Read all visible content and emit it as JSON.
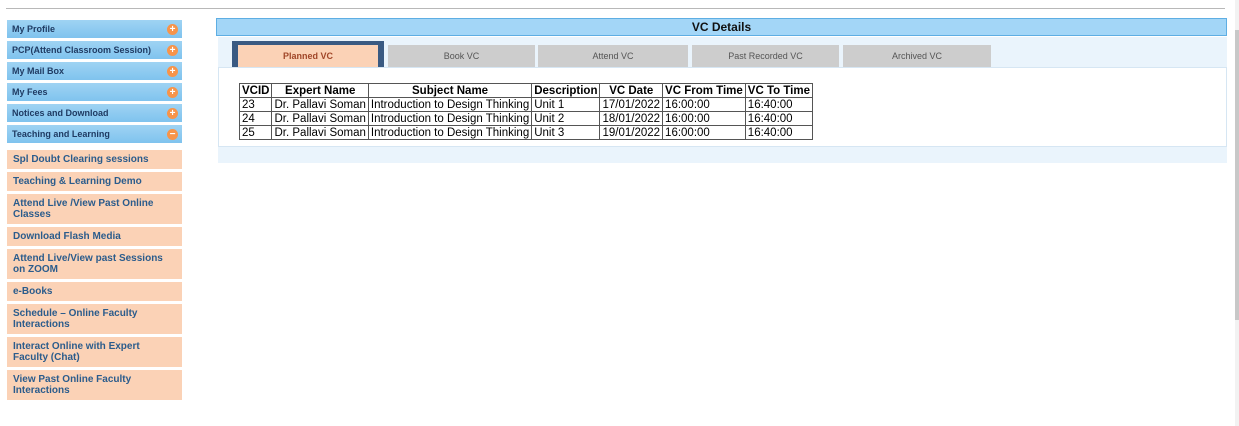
{
  "sidebar": {
    "menu": [
      {
        "label": "My Profile",
        "icon": "plus-icon"
      },
      {
        "label": "PCP(Attend Classroom Session)",
        "icon": "plus-icon"
      },
      {
        "label": "My Mail Box",
        "icon": "plus-icon"
      },
      {
        "label": "My Fees",
        "icon": "plus-icon"
      },
      {
        "label": "Notices and Download",
        "icon": "plus-icon"
      },
      {
        "label": "Teaching and Learning",
        "icon": "minus-icon"
      }
    ],
    "icon_plus": "+",
    "icon_minus": "−",
    "submenu": [
      "Spl Doubt Clearing sessions",
      "Teaching & Learning Demo",
      "Attend Live /View Past Online Classes",
      "Download Flash Media",
      "Attend Live/View past Sessions on ZOOM",
      "e-Books",
      "Schedule – Online Faculty Interactions",
      "Interact Online with Expert Faculty (Chat)",
      "View Past Online Faculty Interactions"
    ]
  },
  "main": {
    "title": "VC Details",
    "tabs": [
      "Planned VC",
      "Book VC",
      "Attend VC",
      "Past Recorded VC",
      "Archived VC"
    ],
    "active_tab": "Planned VC",
    "table": {
      "headers": [
        "VCID",
        "Expert Name",
        "Subject Name",
        "Description",
        "VC Date",
        "VC From Time",
        "VC To Time"
      ],
      "rows": [
        [
          "23",
          "Dr. Pallavi Soman",
          "Introduction to Design Thinking",
          "Unit 1",
          "17/01/2022",
          "16:00:00",
          "16:40:00"
        ],
        [
          "24",
          "Dr. Pallavi Soman",
          "Introduction to Design Thinking",
          "Unit 2",
          "18/01/2022",
          "16:00:00",
          "16:40:00"
        ],
        [
          "25",
          "Dr. Pallavi Soman",
          "Introduction to Design Thinking",
          "Unit 3",
          "19/01/2022",
          "16:00:00",
          "16:40:00"
        ]
      ]
    }
  },
  "colors": {
    "menu_blue": "#9fd3f3",
    "submenu_peach": "#fbd2b6",
    "icon_orange": "#f7944a",
    "header_blue": "#a3d6f7",
    "tab_highlight": "#3a5a82"
  }
}
